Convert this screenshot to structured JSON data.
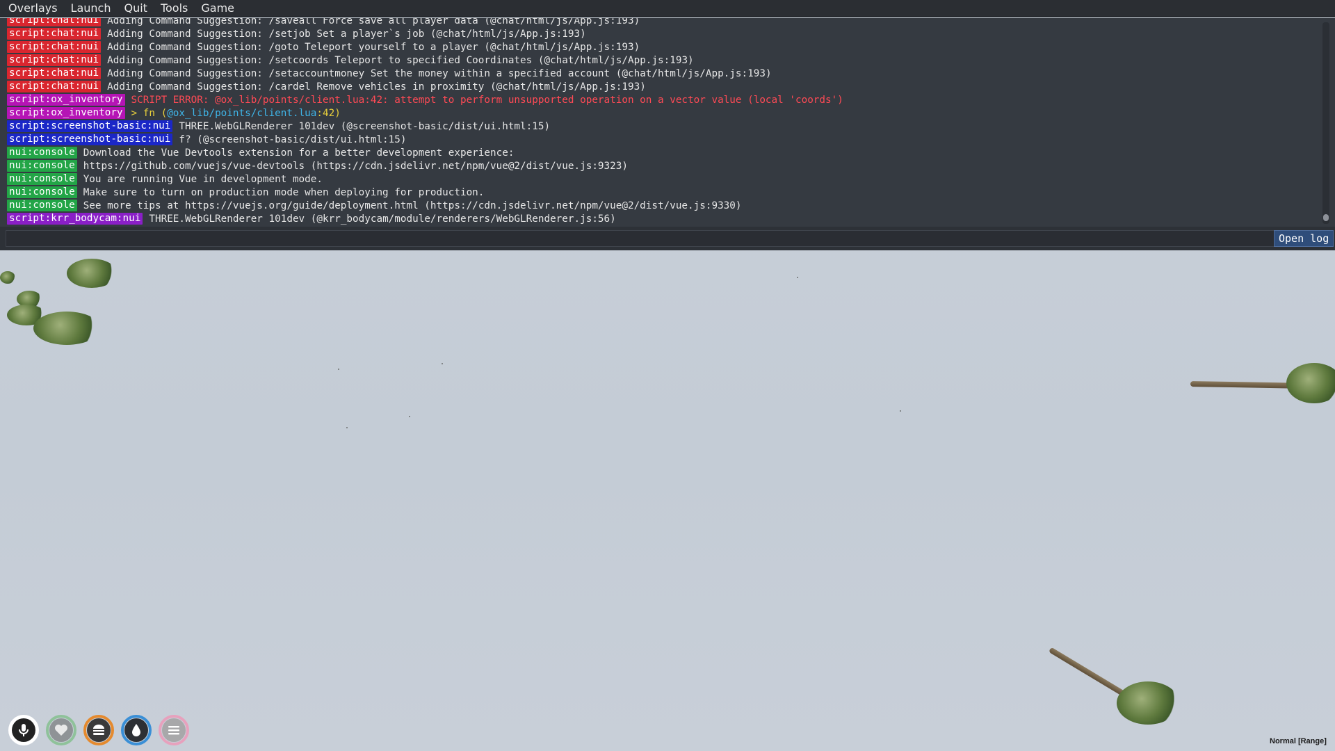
{
  "menubar": {
    "items": [
      "Overlays",
      "Launch",
      "Quit",
      "Tools",
      "Game"
    ]
  },
  "console": {
    "lines": [
      {
        "tag": "script:chat:nui",
        "tag_color": "#d9262f",
        "text": "Adding Command Suggestion: /saveall Force save all player data (@chat/html/js/App.js:193)"
      },
      {
        "tag": "script:chat:nui",
        "tag_color": "#d9262f",
        "text": "Adding Command Suggestion: /setjob Set a player`s job (@chat/html/js/App.js:193)"
      },
      {
        "tag": "script:chat:nui",
        "tag_color": "#d9262f",
        "text": "Adding Command Suggestion: /goto Teleport yourself to a player (@chat/html/js/App.js:193)"
      },
      {
        "tag": "script:chat:nui",
        "tag_color": "#d9262f",
        "text": "Adding Command Suggestion: /setcoords Teleport to specified Coordinates (@chat/html/js/App.js:193)"
      },
      {
        "tag": "script:chat:nui",
        "tag_color": "#d9262f",
        "text": "Adding Command Suggestion: /setaccountmoney Set the money within a specified account (@chat/html/js/App.js:193)"
      },
      {
        "tag": "script:chat:nui",
        "tag_color": "#d9262f",
        "text": "Adding Command Suggestion: /cardel Remove vehicles in proximity (@chat/html/js/App.js:193)"
      },
      {
        "tag": "script:ox_inventory",
        "tag_color": "#b514b5",
        "text": "SCRIPT ERROR: @ox_lib/points/client.lua:42: attempt to perform unsupported operation on a vector value (local 'coords')"
      },
      {
        "tag": "script:ox_inventory",
        "tag_color": "#b514b5",
        "text_pre": "> fn (",
        "text_path": "@ox_lib/points/client.lua",
        "text_post": ":42)"
      },
      {
        "tag": "script:screenshot-basic:nui",
        "tag_color": "#1b27c7",
        "text": "THREE.WebGLRenderer 101dev (@screenshot-basic/dist/ui.html:15)"
      },
      {
        "tag": "script:screenshot-basic:nui",
        "tag_color": "#1b27c7",
        "text": "f? (@screenshot-basic/dist/ui.html:15)"
      },
      {
        "tag": "nui:console",
        "tag_color": "#23a547",
        "text": "Download the Vue Devtools extension for a better development experience:"
      },
      {
        "tag": "nui:console",
        "tag_color": "#23a547",
        "text": "https://github.com/vuejs/vue-devtools (https://cdn.jsdelivr.net/npm/vue@2/dist/vue.js:9323)"
      },
      {
        "tag": "nui:console",
        "tag_color": "#23a547",
        "text": "You are running Vue in development mode."
      },
      {
        "tag": "nui:console",
        "tag_color": "#23a547",
        "text": "Make sure to turn on production mode when deploying for production."
      },
      {
        "tag": "nui:console",
        "tag_color": "#23a547",
        "text": "See more tips at https://vuejs.org/guide/deployment.html (https://cdn.jsdelivr.net/npm/vue@2/dist/vue.js:9330)"
      },
      {
        "tag": "script:krr_bodycam:nui",
        "tag_color": "#8a1fc7",
        "text": "THREE.WebGLRenderer 101dev (@krr_bodycam/module/renderers/WebGLRenderer.js:56)"
      }
    ],
    "input_value": "",
    "open_log_label": "Open log"
  },
  "hud": {
    "icons": [
      "microphone-icon",
      "heart-icon",
      "burger-icon",
      "water-drop-icon",
      "stress-icon"
    ]
  },
  "voice_mode": "Normal [Range]"
}
